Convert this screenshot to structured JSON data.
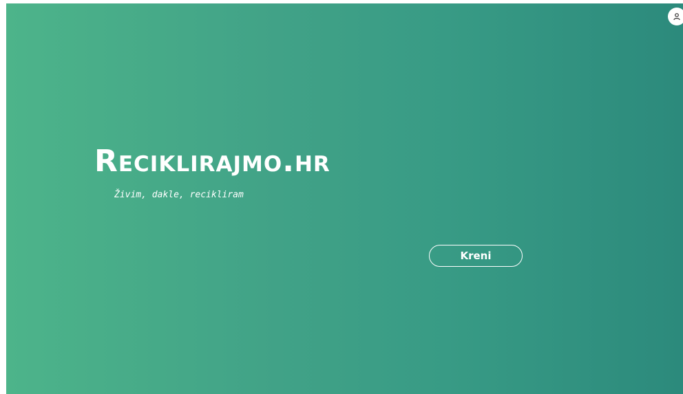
{
  "hero": {
    "title": "Reciklirajmo.hr",
    "tagline": "Živim, dakle, recikliram"
  },
  "actions": {
    "start_label": "Kreni"
  },
  "header": {
    "user_icon": "user-icon"
  },
  "colors": {
    "gradient_start": "#4db48a",
    "gradient_end": "#2c8a7c",
    "text": "#ffffff"
  }
}
